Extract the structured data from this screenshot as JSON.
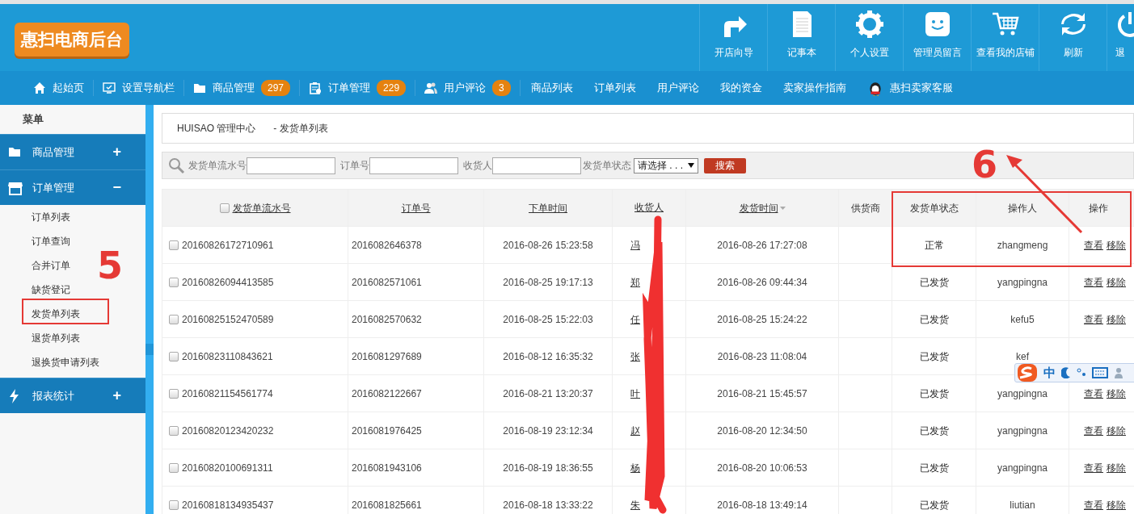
{
  "header": {
    "logo": "惠扫电商后台",
    "tools": [
      {
        "label": "开店向导",
        "kind": "turn"
      },
      {
        "label": "记事本",
        "kind": "note"
      },
      {
        "label": "个人设置",
        "kind": "gear"
      },
      {
        "label": "管理员留言",
        "kind": "smile"
      },
      {
        "label": "查看我的店铺",
        "kind": "cart"
      },
      {
        "label": "刷新",
        "kind": "refresh"
      },
      {
        "label": "退",
        "kind": "power"
      }
    ]
  },
  "nav": [
    {
      "label": "起始页",
      "kind": "home"
    },
    {
      "label": "设置导航栏",
      "kind": "monitor"
    },
    {
      "label": "商品管理",
      "kind": "folder",
      "badge": "297"
    },
    {
      "label": "订单管理",
      "kind": "clipboard",
      "badge": "229"
    },
    {
      "label": "用户评论",
      "kind": "users",
      "badge": "3"
    },
    {
      "label": "商品列表"
    },
    {
      "label": "订单列表"
    },
    {
      "label": "用户评论"
    },
    {
      "label": "我的资金"
    },
    {
      "label": "卖家操作指南"
    },
    {
      "label": "惠扫卖家客服",
      "kind": "penguin"
    }
  ],
  "sidebar": {
    "title": "菜单",
    "groups": [
      {
        "label": "商品管理",
        "kind": "folder",
        "toggle": "+"
      },
      {
        "label": "订单管理",
        "kind": "store",
        "toggle": "−",
        "items": [
          "订单列表",
          "订单查询",
          "合并订单",
          "缺货登记",
          "发货单列表",
          "退货单列表",
          "退换货申请列表"
        ]
      },
      {
        "label": "报表统计",
        "kind": "bolt",
        "toggle": "+"
      }
    ]
  },
  "breadcrumb": [
    "HUISAO 管理中心",
    "- 发货单列表"
  ],
  "search": {
    "fields": [
      "发货单流水号",
      "订单号",
      "收货人"
    ],
    "status_label": "发货单状态",
    "status_value": "请选择 . . .",
    "button": "搜索"
  },
  "table": {
    "all_checked": false,
    "columns": [
      {
        "label": "发货单流水号",
        "link": true
      },
      {
        "label": "订单号",
        "link": true
      },
      {
        "label": "下单时间",
        "link": true
      },
      {
        "label": "收货人",
        "link": true
      },
      {
        "label": "发货时间",
        "link": true,
        "sorted": true
      },
      {
        "label": "供货商",
        "link": false
      },
      {
        "label": "发货单状态",
        "link": false
      },
      {
        "label": "操作人",
        "link": false
      },
      {
        "label": "操作",
        "link": false
      }
    ],
    "rows": [
      {
        "checked": false,
        "cells": [
          "20160826172710961",
          "2016082646378",
          "2016-08-26 15:23:58",
          "冯",
          "2016-08-26 17:27:08",
          "",
          "正常",
          "zhangmeng"
        ],
        "actions": [
          "查看",
          "移除"
        ]
      },
      {
        "checked": false,
        "cells": [
          "20160826094413585",
          "2016082571061",
          "2016-08-25 19:17:13",
          "郑",
          "2016-08-26 09:44:34",
          "",
          "已发货",
          "yangpingna"
        ],
        "actions": [
          "查看",
          "移除"
        ]
      },
      {
        "checked": false,
        "cells": [
          "20160825152470589",
          "2016082570632",
          "2016-08-25 15:22:03",
          "任",
          "2016-08-25 15:24:22",
          "",
          "已发货",
          "kefu5"
        ],
        "actions": [
          "查看",
          "移除"
        ]
      },
      {
        "checked": false,
        "cells": [
          "20160823110843621",
          "2016081297689",
          "2016-08-12 16:35:32",
          "张",
          "2016-08-23 11:08:04",
          "",
          "已发货",
          "kef"
        ],
        "actions": []
      },
      {
        "checked": false,
        "cells": [
          "20160821154561774",
          "2016082122667",
          "2016-08-21 13:20:37",
          "叶",
          "2016-08-21 15:45:57",
          "",
          "已发货",
          "yangpingna"
        ],
        "actions": [
          "查看",
          "移除"
        ]
      },
      {
        "checked": false,
        "cells": [
          "20160820123420232",
          "2016081976425",
          "2016-08-19 23:12:34",
          "赵",
          "2016-08-20 12:34:50",
          "",
          "已发货",
          "yangpingna"
        ],
        "actions": [
          "查看",
          "移除"
        ]
      },
      {
        "checked": false,
        "cells": [
          "20160820100691311",
          "2016081943106",
          "2016-08-19 18:36:55",
          "杨",
          "2016-08-20 10:06:53",
          "",
          "已发货",
          "yangpingna"
        ],
        "actions": [
          "查看",
          "移除"
        ]
      },
      {
        "checked": false,
        "cells": [
          "20160818134935437",
          "2016081825661",
          "2016-08-18 13:33:22",
          "朱",
          "2016-08-18 13:49:14",
          "",
          "已发货",
          "liutian"
        ],
        "actions": [
          "查看",
          "移除"
        ]
      }
    ]
  },
  "ime_toolbar": {
    "mode": "中"
  },
  "annotations": {
    "marks": [
      "5",
      "6"
    ]
  }
}
